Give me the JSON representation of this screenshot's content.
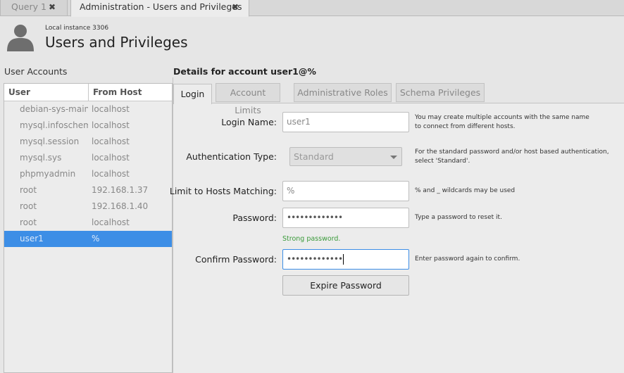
{
  "tabs": [
    {
      "label": "Query 1",
      "close": "✖"
    },
    {
      "label": "Administration - Users and Privileges",
      "close": "✖"
    }
  ],
  "header": {
    "instance": "Local instance 3306",
    "title": "Users and Privileges"
  },
  "user_accounts": {
    "label": "User Accounts",
    "columns": [
      "User",
      "From Host"
    ],
    "rows": [
      {
        "user": "debian-sys-maint",
        "host": "localhost"
      },
      {
        "user": "mysql.infoschema",
        "host": "localhost"
      },
      {
        "user": "mysql.session",
        "host": "localhost"
      },
      {
        "user": "mysql.sys",
        "host": "localhost"
      },
      {
        "user": "phpmyadmin",
        "host": "localhost"
      },
      {
        "user": "root",
        "host": "192.168.1.37"
      },
      {
        "user": "root",
        "host": "192.168.1.40"
      },
      {
        "user": "root",
        "host": "localhost"
      },
      {
        "user": "user1",
        "host": "%"
      }
    ],
    "selected": "user1"
  },
  "details": {
    "title": "Details for account user1@%",
    "tabs": [
      "Login",
      "Account Limits",
      "Administrative Roles",
      "Schema Privileges"
    ],
    "active_tab": "Login",
    "login_name": {
      "label": "Login Name:",
      "value": "user1",
      "help1": "You may create multiple accounts with the same name",
      "help2": "to connect from different hosts."
    },
    "auth_type": {
      "label": "Authentication Type:",
      "value": "Standard",
      "help1": "For the standard password and/or host based authentication,",
      "help2": "select 'Standard'."
    },
    "hosts": {
      "label": "Limit to Hosts Matching:",
      "value": "%",
      "help": "% and _ wildcards may be used"
    },
    "password": {
      "label": "Password:",
      "value": "•••••••••••••",
      "help": "Type a password to reset it.",
      "strength": "Strong password."
    },
    "confirm": {
      "label": "Confirm Password:",
      "value": "•••••••••••••",
      "help": "Enter password again to confirm."
    },
    "expire_button": "Expire Password"
  },
  "colors": {
    "selection": "#3d8ee6",
    "strong": "#3a9a3a",
    "focus": "#3d8ee6"
  }
}
